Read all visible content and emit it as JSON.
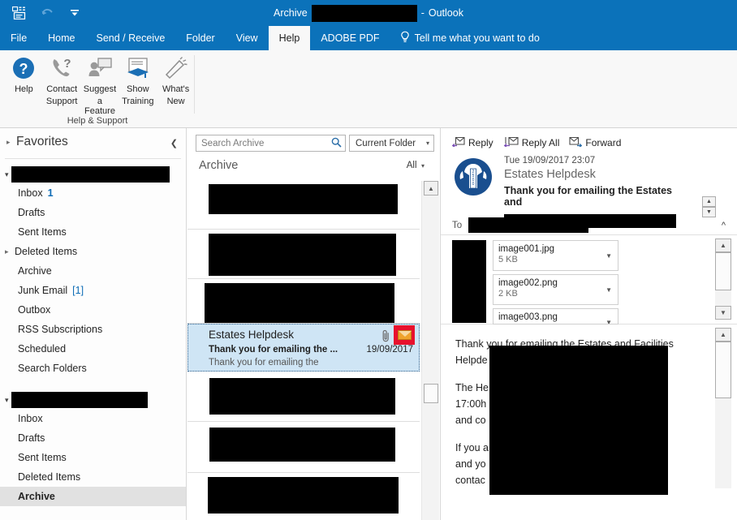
{
  "window": {
    "title_prefix": "Archive",
    "title_separator": "-",
    "title_suffix": "Outlook",
    "accent_color": "#0b72ba"
  },
  "quick_access": [
    {
      "name": "send-receive-icon",
      "label": "Send/Receive All Folders"
    },
    {
      "name": "undo-icon",
      "label": "Undo"
    },
    {
      "name": "customize-qat-icon",
      "label": "Customize Quick Access Toolbar"
    }
  ],
  "ribbon": {
    "tabs": [
      {
        "label": "File",
        "active": false
      },
      {
        "label": "Home",
        "active": false
      },
      {
        "label": "Send / Receive",
        "active": false
      },
      {
        "label": "Folder",
        "active": false
      },
      {
        "label": "View",
        "active": false
      },
      {
        "label": "Help",
        "active": true
      },
      {
        "label": "ADOBE PDF",
        "active": false
      }
    ],
    "tell_me": "Tell me what you want to do",
    "group_title": "Help & Support",
    "commands": [
      {
        "label_line1": "Help",
        "label_line2": "",
        "icon": "help-question-icon"
      },
      {
        "label_line1": "Contact",
        "label_line2": "Support",
        "icon": "phone-question-icon"
      },
      {
        "label_line1": "Suggest",
        "label_line2": "a Feature",
        "icon": "person-speech-icon"
      },
      {
        "label_line1": "Show",
        "label_line2": "Training",
        "icon": "graduation-cap-icon"
      },
      {
        "label_line1": "What's",
        "label_line2": "New",
        "icon": "megaphone-icon"
      }
    ]
  },
  "folder_pane": {
    "favorites_label": "Favorites",
    "accounts": [
      {
        "name_redacted": true,
        "folders": [
          {
            "label": "Inbox",
            "count": "1",
            "expandable": false
          },
          {
            "label": "Drafts",
            "count": "",
            "expandable": false
          },
          {
            "label": "Sent Items",
            "count": "",
            "expandable": false
          },
          {
            "label": "Deleted Items",
            "count": "",
            "expandable": true
          },
          {
            "label": "Archive",
            "count": "",
            "expandable": false
          },
          {
            "label": "Junk Email",
            "count": "[1]",
            "expandable": false
          },
          {
            "label": "Outbox",
            "count": "",
            "expandable": false
          },
          {
            "label": "RSS Subscriptions",
            "count": "",
            "expandable": false
          },
          {
            "label": "Scheduled",
            "count": "",
            "expandable": false
          },
          {
            "label": "Search Folders",
            "count": "",
            "expandable": false
          }
        ]
      },
      {
        "name_redacted": true,
        "folders": [
          {
            "label": "Inbox",
            "count": "",
            "expandable": false
          },
          {
            "label": "Drafts",
            "count": "",
            "expandable": false
          },
          {
            "label": "Sent Items",
            "count": "",
            "expandable": false
          },
          {
            "label": "Deleted Items",
            "count": "",
            "expandable": false
          },
          {
            "label": "Archive",
            "count": "",
            "expandable": false,
            "selected": true
          }
        ]
      }
    ]
  },
  "message_list": {
    "search_placeholder": "Search Archive",
    "scope_label": "Current Folder",
    "folder_name": "Archive",
    "filter_label": "All",
    "selected_message": {
      "from": "Estates Helpdesk",
      "subject": "Thank you for emailing the ...",
      "preview": "Thank you for emailing the",
      "date": "19/09/2017",
      "has_attachment": true,
      "unread_icon": "envelope-icon",
      "highlight_color": "#e8112d"
    },
    "redacted_rows_above": 3,
    "redacted_rows_below": 3
  },
  "reading_pane": {
    "actions": [
      {
        "label": "Reply",
        "icon": "reply-icon"
      },
      {
        "label": "Reply All",
        "icon": "reply-all-icon"
      },
      {
        "label": "Forward",
        "icon": "forward-icon"
      }
    ],
    "date": "Tue 19/09/2017 23:07",
    "sender": "Estates Helpdesk",
    "subject": "Thank you for emailing the Estates and",
    "to_label": "To",
    "to_redacted": true,
    "attachments": [
      {
        "name": "image001.jpg",
        "size": "5 KB"
      },
      {
        "name": "image002.png",
        "size": "2 KB"
      },
      {
        "name": "image003.png",
        "size": ""
      }
    ],
    "body_lines": [
      "Thank you for emailing the Estates and Facilities",
      "Helpde",
      "The He",
      "17:00h",
      "and co",
      "If you a",
      "and yo",
      "contac"
    ]
  }
}
